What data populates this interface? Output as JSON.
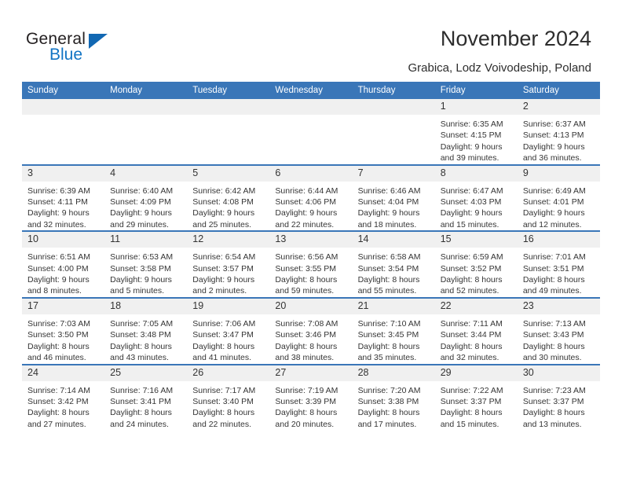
{
  "brand": {
    "name_part1": "General",
    "name_part2": "Blue"
  },
  "header": {
    "title": "November 2024",
    "subtitle": "Grabica, Lodz Voivodeship, Poland"
  },
  "calendar": {
    "weekday_headers": [
      "Sunday",
      "Monday",
      "Tuesday",
      "Wednesday",
      "Thursday",
      "Friday",
      "Saturday"
    ],
    "accent_color": "#3a76b8",
    "daynum_bg": "#f0f0f0",
    "weeks": [
      [
        {
          "day": "",
          "empty": true
        },
        {
          "day": "",
          "empty": true
        },
        {
          "day": "",
          "empty": true
        },
        {
          "day": "",
          "empty": true
        },
        {
          "day": "",
          "empty": true
        },
        {
          "day": "1",
          "sunrise": "Sunrise: 6:35 AM",
          "sunset": "Sunset: 4:15 PM",
          "daylight1": "Daylight: 9 hours",
          "daylight2": "and 39 minutes."
        },
        {
          "day": "2",
          "sunrise": "Sunrise: 6:37 AM",
          "sunset": "Sunset: 4:13 PM",
          "daylight1": "Daylight: 9 hours",
          "daylight2": "and 36 minutes."
        }
      ],
      [
        {
          "day": "3",
          "sunrise": "Sunrise: 6:39 AM",
          "sunset": "Sunset: 4:11 PM",
          "daylight1": "Daylight: 9 hours",
          "daylight2": "and 32 minutes."
        },
        {
          "day": "4",
          "sunrise": "Sunrise: 6:40 AM",
          "sunset": "Sunset: 4:09 PM",
          "daylight1": "Daylight: 9 hours",
          "daylight2": "and 29 minutes."
        },
        {
          "day": "5",
          "sunrise": "Sunrise: 6:42 AM",
          "sunset": "Sunset: 4:08 PM",
          "daylight1": "Daylight: 9 hours",
          "daylight2": "and 25 minutes."
        },
        {
          "day": "6",
          "sunrise": "Sunrise: 6:44 AM",
          "sunset": "Sunset: 4:06 PM",
          "daylight1": "Daylight: 9 hours",
          "daylight2": "and 22 minutes."
        },
        {
          "day": "7",
          "sunrise": "Sunrise: 6:46 AM",
          "sunset": "Sunset: 4:04 PM",
          "daylight1": "Daylight: 9 hours",
          "daylight2": "and 18 minutes."
        },
        {
          "day": "8",
          "sunrise": "Sunrise: 6:47 AM",
          "sunset": "Sunset: 4:03 PM",
          "daylight1": "Daylight: 9 hours",
          "daylight2": "and 15 minutes."
        },
        {
          "day": "9",
          "sunrise": "Sunrise: 6:49 AM",
          "sunset": "Sunset: 4:01 PM",
          "daylight1": "Daylight: 9 hours",
          "daylight2": "and 12 minutes."
        }
      ],
      [
        {
          "day": "10",
          "sunrise": "Sunrise: 6:51 AM",
          "sunset": "Sunset: 4:00 PM",
          "daylight1": "Daylight: 9 hours",
          "daylight2": "and 8 minutes."
        },
        {
          "day": "11",
          "sunrise": "Sunrise: 6:53 AM",
          "sunset": "Sunset: 3:58 PM",
          "daylight1": "Daylight: 9 hours",
          "daylight2": "and 5 minutes."
        },
        {
          "day": "12",
          "sunrise": "Sunrise: 6:54 AM",
          "sunset": "Sunset: 3:57 PM",
          "daylight1": "Daylight: 9 hours",
          "daylight2": "and 2 minutes."
        },
        {
          "day": "13",
          "sunrise": "Sunrise: 6:56 AM",
          "sunset": "Sunset: 3:55 PM",
          "daylight1": "Daylight: 8 hours",
          "daylight2": "and 59 minutes."
        },
        {
          "day": "14",
          "sunrise": "Sunrise: 6:58 AM",
          "sunset": "Sunset: 3:54 PM",
          "daylight1": "Daylight: 8 hours",
          "daylight2": "and 55 minutes."
        },
        {
          "day": "15",
          "sunrise": "Sunrise: 6:59 AM",
          "sunset": "Sunset: 3:52 PM",
          "daylight1": "Daylight: 8 hours",
          "daylight2": "and 52 minutes."
        },
        {
          "day": "16",
          "sunrise": "Sunrise: 7:01 AM",
          "sunset": "Sunset: 3:51 PM",
          "daylight1": "Daylight: 8 hours",
          "daylight2": "and 49 minutes."
        }
      ],
      [
        {
          "day": "17",
          "sunrise": "Sunrise: 7:03 AM",
          "sunset": "Sunset: 3:50 PM",
          "daylight1": "Daylight: 8 hours",
          "daylight2": "and 46 minutes."
        },
        {
          "day": "18",
          "sunrise": "Sunrise: 7:05 AM",
          "sunset": "Sunset: 3:48 PM",
          "daylight1": "Daylight: 8 hours",
          "daylight2": "and 43 minutes."
        },
        {
          "day": "19",
          "sunrise": "Sunrise: 7:06 AM",
          "sunset": "Sunset: 3:47 PM",
          "daylight1": "Daylight: 8 hours",
          "daylight2": "and 41 minutes."
        },
        {
          "day": "20",
          "sunrise": "Sunrise: 7:08 AM",
          "sunset": "Sunset: 3:46 PM",
          "daylight1": "Daylight: 8 hours",
          "daylight2": "and 38 minutes."
        },
        {
          "day": "21",
          "sunrise": "Sunrise: 7:10 AM",
          "sunset": "Sunset: 3:45 PM",
          "daylight1": "Daylight: 8 hours",
          "daylight2": "and 35 minutes."
        },
        {
          "day": "22",
          "sunrise": "Sunrise: 7:11 AM",
          "sunset": "Sunset: 3:44 PM",
          "daylight1": "Daylight: 8 hours",
          "daylight2": "and 32 minutes."
        },
        {
          "day": "23",
          "sunrise": "Sunrise: 7:13 AM",
          "sunset": "Sunset: 3:43 PM",
          "daylight1": "Daylight: 8 hours",
          "daylight2": "and 30 minutes."
        }
      ],
      [
        {
          "day": "24",
          "sunrise": "Sunrise: 7:14 AM",
          "sunset": "Sunset: 3:42 PM",
          "daylight1": "Daylight: 8 hours",
          "daylight2": "and 27 minutes."
        },
        {
          "day": "25",
          "sunrise": "Sunrise: 7:16 AM",
          "sunset": "Sunset: 3:41 PM",
          "daylight1": "Daylight: 8 hours",
          "daylight2": "and 24 minutes."
        },
        {
          "day": "26",
          "sunrise": "Sunrise: 7:17 AM",
          "sunset": "Sunset: 3:40 PM",
          "daylight1": "Daylight: 8 hours",
          "daylight2": "and 22 minutes."
        },
        {
          "day": "27",
          "sunrise": "Sunrise: 7:19 AM",
          "sunset": "Sunset: 3:39 PM",
          "daylight1": "Daylight: 8 hours",
          "daylight2": "and 20 minutes."
        },
        {
          "day": "28",
          "sunrise": "Sunrise: 7:20 AM",
          "sunset": "Sunset: 3:38 PM",
          "daylight1": "Daylight: 8 hours",
          "daylight2": "and 17 minutes."
        },
        {
          "day": "29",
          "sunrise": "Sunrise: 7:22 AM",
          "sunset": "Sunset: 3:37 PM",
          "daylight1": "Daylight: 8 hours",
          "daylight2": "and 15 minutes."
        },
        {
          "day": "30",
          "sunrise": "Sunrise: 7:23 AM",
          "sunset": "Sunset: 3:37 PM",
          "daylight1": "Daylight: 8 hours",
          "daylight2": "and 13 minutes."
        }
      ]
    ]
  }
}
